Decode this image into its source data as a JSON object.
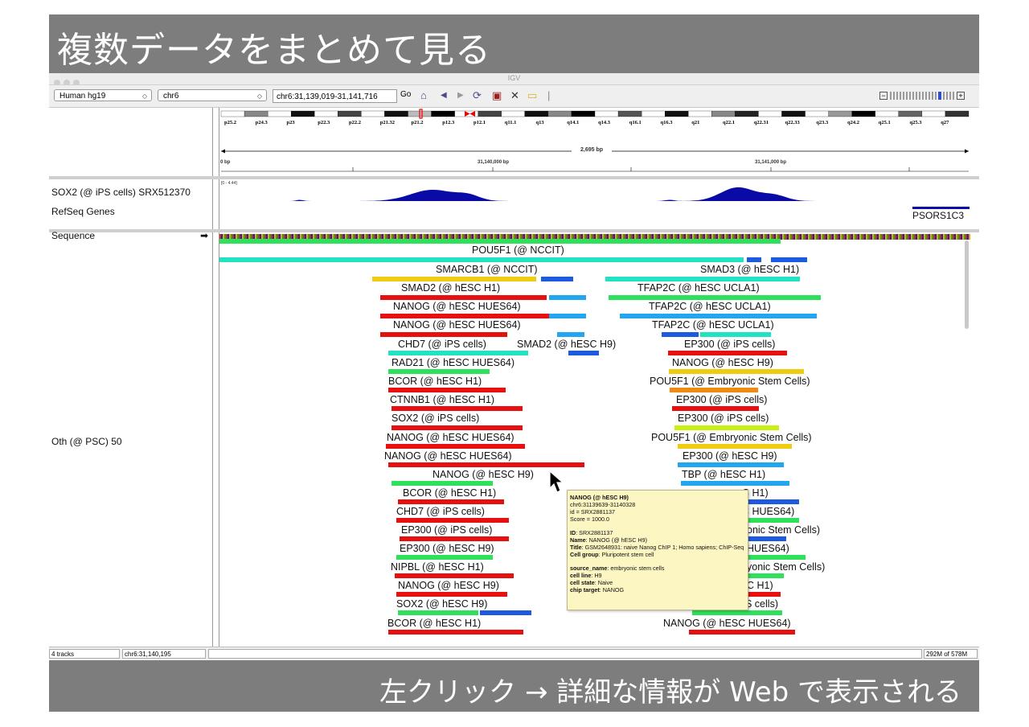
{
  "slide": {
    "title": "複数データをまとめて見る",
    "caption": "左クリック → 詳細な情報が Web で表示される"
  },
  "window": {
    "title": "IGV"
  },
  "toolbar": {
    "genome": "Human hg19",
    "chromosome": "chr6",
    "locus": "chr6:31,139,019-31,141,716",
    "go_label": "Go"
  },
  "ideogram": {
    "bands": [
      "p25.2",
      "p24.3",
      "p23",
      "p22.3",
      "p22.2",
      "p21.32",
      "p21.2",
      "p12.3",
      "p12.1",
      "q11.1",
      "q13",
      "q14.1",
      "q14.3",
      "q16.1",
      "q16.3",
      "q21",
      "q22.1",
      "q22.31",
      "q22.33",
      "q23.3",
      "q24.2",
      "q25.1",
      "q25.3",
      "q27"
    ]
  },
  "ruler": {
    "span": "2,695 bp",
    "start": "0 bp",
    "tick1": "31,140,000 bp",
    "tick2": "31,141,000 bp"
  },
  "tracks": {
    "sox2": {
      "label": "SOX2 (@ iPS cells) SRX512370",
      "range": "[0 - 4.44]"
    },
    "refseq": {
      "label": "RefSeq Genes",
      "gene": "PSORS1C3"
    },
    "sequence": {
      "label": "Sequence",
      "arrow": "➡"
    },
    "oth": {
      "label": "Oth (@ PSC) 50"
    }
  },
  "features_left": [
    "POU5F1 (@ NCCIT)",
    "SMARCB1 (@ NCCIT)",
    "SMAD2 (@ hESC H1)",
    "NANOG (@ hESC HUES64)",
    "NANOG (@ hESC HUES64)",
    "CHD7 (@ iPS cells)",
    "RAD21 (@ hESC HUES64)",
    "BCOR (@ hESC H1)",
    "CTNNB1 (@ hESC H1)",
    "SOX2 (@ iPS cells)",
    "NANOG (@ hESC HUES64)",
    "NANOG (@ hESC HUES64)",
    "NANOG (@ hESC H9)",
    "BCOR (@ hESC H1)",
    "CHD7 (@ iPS cells)",
    "EP300 (@ iPS cells)",
    "EP300 (@ hESC H9)",
    "NIPBL (@ hESC H1)",
    "NANOG (@ hESC H9)",
    "SOX2 (@ hESC H9)",
    "BCOR (@ hESC H1)",
    "SMAD2 (@ hESC H9)"
  ],
  "features_right": [
    "SMAD3 (@ hESC H1)",
    "TFAP2C (@ hESC UCLA1)",
    "TFAP2C (@ hESC UCLA1)",
    "TFAP2C (@ hESC UCLA1)",
    "EP300 (@ iPS cells)",
    "NANOG (@ hESC H9)",
    "POU5F1 (@ Embryonic Stem Cells)",
    "EP300 (@ iPS cells)",
    "EP300 (@ iPS cells)",
    "POU5F1 (@ Embryonic Stem Cells)",
    "EP300 (@ hESC H9)",
    "TBP (@ hESC H1)",
    "C H1)",
    "C HUES64)",
    "onic Stem Cells)",
    "HUES64)",
    "yonic Stem Cells)",
    "C H1)",
    "S cells)",
    "NANOG (@ hESC HUES64)"
  ],
  "popup": {
    "header": "NANOG (@ hESC H9)",
    "coords": "chr6:31139639-31140328",
    "id_line": "id = SRX2881137",
    "score": "Score = 1000.0",
    "id_key": "ID",
    "id_val": ": SRX2881137",
    "name_key": "Name",
    "name_val": ": NANOG (@ hESC H9)",
    "title_key": "Title",
    "title_val": ": GSM2648931: naive Nanog ChIP 1; Homo sapiens; ChIP-Seq",
    "group_key": "Cell group",
    "group_val": ": Pluripotent stem cell",
    "src_key": "source_name",
    "src_val": ": embryonic stem cells",
    "line_key": "cell line",
    "line_val": ": H9",
    "state_key": "cell state",
    "state_val": ": Naive",
    "target_key": "chip target",
    "target_val": ": NANOG"
  },
  "status": {
    "tracks": "4 tracks",
    "position": "chr6:31,140,195",
    "memory": "292M of 578M"
  },
  "colors": {
    "banner": "#7d7d7d",
    "coverage": "#0a0aa6",
    "green": "#2ee05a",
    "red": "#e8100e",
    "cyan": "#22e2c4",
    "blue": "#1c5be0",
    "skyblue": "#22a6f0",
    "yellow": "#f0cc10",
    "orange": "#f08a10",
    "lime": "#c8f010",
    "popup_bg": "#fbf6c2"
  }
}
